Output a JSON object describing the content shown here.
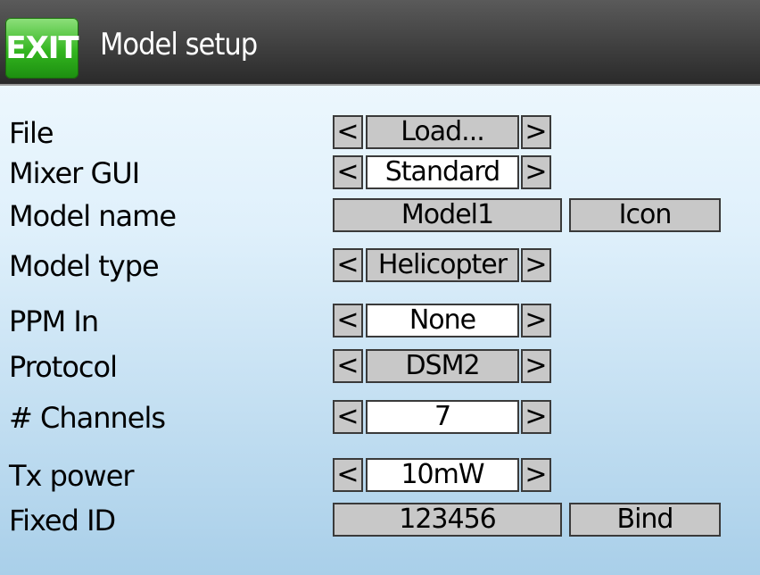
{
  "header": {
    "exit_label": "EXIT",
    "title": "Model setup"
  },
  "rows": [
    {
      "label": "File",
      "value": "Load...",
      "style": "gray"
    },
    {
      "label": "Mixer GUI",
      "value": "Standard",
      "style": "white"
    },
    {
      "label": "Model name",
      "value": "Model1",
      "extra_button": "Icon"
    },
    {
      "label": "Model type",
      "value": "Helicopter",
      "style": "gray"
    },
    {
      "label": "PPM In",
      "value": "None",
      "style": "white"
    },
    {
      "label": "Protocol",
      "value": "DSM2",
      "style": "gray"
    },
    {
      "label": "# Channels",
      "value": "7",
      "style": "white"
    },
    {
      "label": "Tx power",
      "value": "10mW",
      "style": "white"
    },
    {
      "label": "Fixed ID",
      "value": "123456",
      "extra_button": "Bind"
    }
  ],
  "arrows": {
    "left": "<",
    "right": ">"
  }
}
